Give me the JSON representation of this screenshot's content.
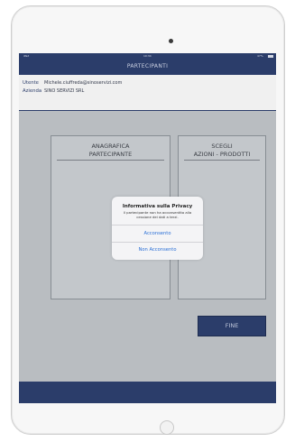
{
  "navigation": {
    "title": "PARTECIPANTI",
    "status_left": "iPad",
    "status_time": "10:34",
    "status_right": "47%"
  },
  "info": {
    "user_label": "Utente",
    "user_value": "Michele.ciuffreda@sinoservizi.com",
    "company_label": "Azienda",
    "company_value": "SINO SERVIZI SRL"
  },
  "panels": {
    "left_title_line1": "ANAGRAFICA",
    "left_title_line2": "PARTECIPANTE",
    "right_title_line1": "SCEGLI",
    "right_title_line2": "AZIONI - PRODOTTI"
  },
  "buttons": {
    "fine_label": "FINE"
  },
  "alert": {
    "title": "Informativa sulla Privacy",
    "message": "Il partecipante non ha acconsentito alla cessione dei dati a terzi.",
    "button_1": "Acconsento",
    "button_2": "Non Acconsento"
  },
  "colors": {
    "nav_bar": "#2a3d6e",
    "background": "#c4c8cd",
    "alert_button_text": "#2a6fd6"
  }
}
